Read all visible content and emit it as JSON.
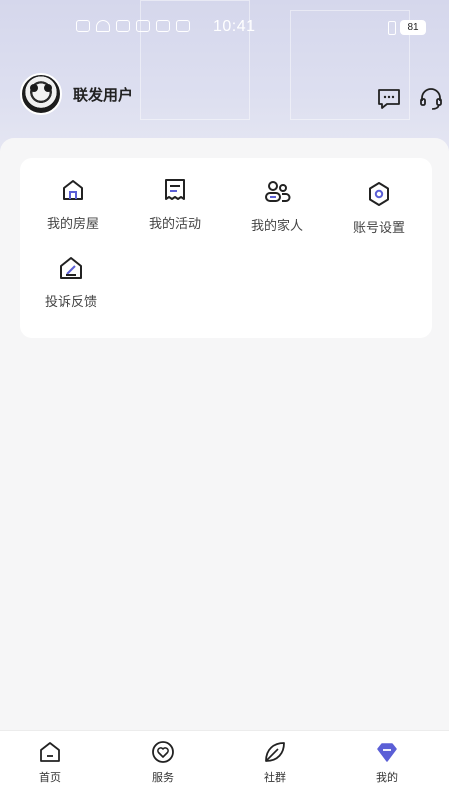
{
  "status_bar": {
    "time": "10:41",
    "battery": "81"
  },
  "profile": {
    "username": "联发用户",
    "avatar_icon": "panda-avatar"
  },
  "header_actions": [
    {
      "icon": "message-icon"
    },
    {
      "icon": "headset-icon"
    }
  ],
  "menu": {
    "items": [
      {
        "label": "我的房屋",
        "icon": "house-icon"
      },
      {
        "label": "我的活动",
        "icon": "receipt-icon"
      },
      {
        "label": "我的家人",
        "icon": "family-icon"
      },
      {
        "label": "账号设置",
        "icon": "hexagon-settings-icon"
      },
      {
        "label": "投诉反馈",
        "icon": "feedback-edit-icon"
      }
    ]
  },
  "tabbar": {
    "tabs": [
      {
        "label": "首页",
        "icon": "home-icon",
        "active": false
      },
      {
        "label": "服务",
        "icon": "heart-circle-icon",
        "active": false
      },
      {
        "label": "社群",
        "icon": "leaf-icon",
        "active": false
      },
      {
        "label": "我的",
        "icon": "gem-icon",
        "active": true
      }
    ]
  },
  "colors": {
    "accent": "#5b5fd6",
    "header_bg": "#d9dbee",
    "page_bg": "#f6f6f7",
    "text": "#222222"
  }
}
